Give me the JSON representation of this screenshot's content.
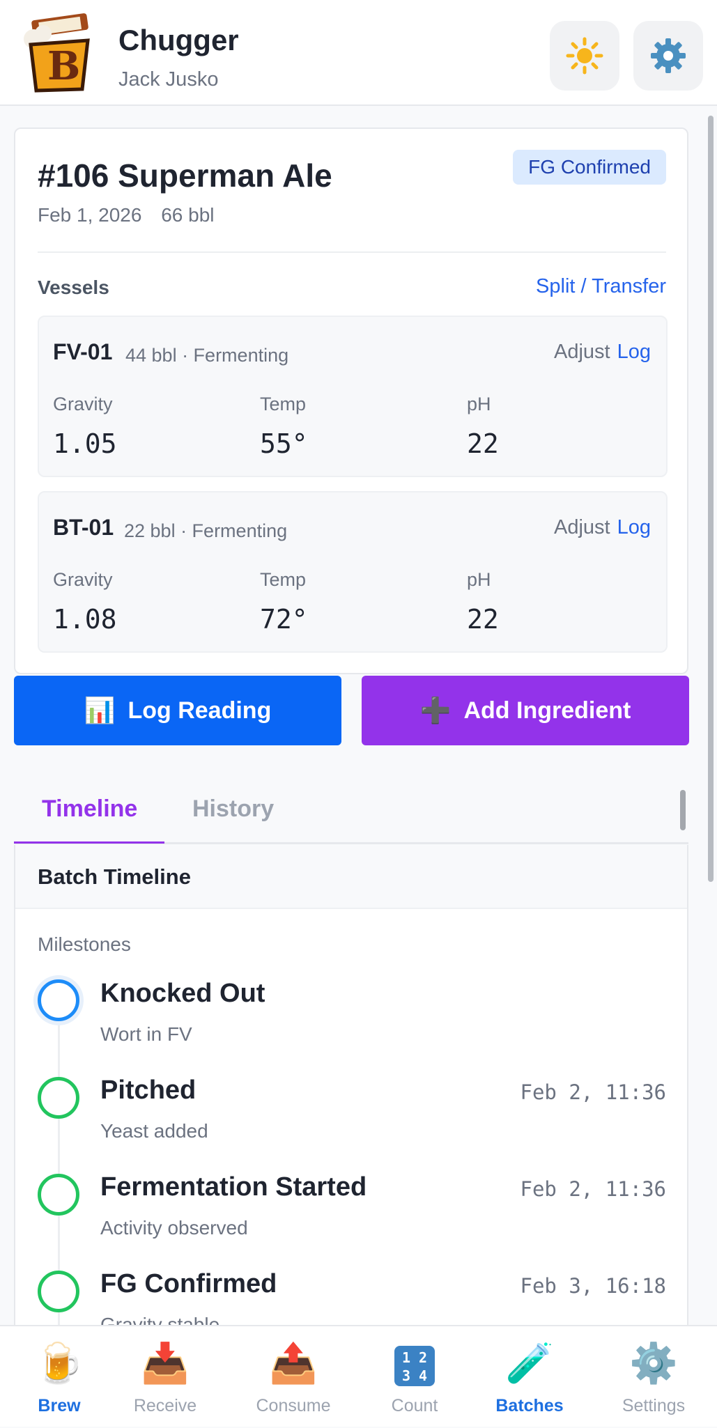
{
  "app": {
    "title": "Chugger",
    "user": "Jack Jusko"
  },
  "header": {
    "theme_icon": "sun-icon",
    "settings_icon": "gear-icon"
  },
  "batch": {
    "title": "#106 Superman Ale",
    "status": "FG Confirmed",
    "date": "Feb 1, 2026",
    "volume": "66 bbl",
    "vessels_label": "Vessels",
    "split_label": "Split / Transfer",
    "vessels": [
      {
        "name": "FV-01",
        "info": "44 bbl · Fermenting",
        "adjust": "Adjust",
        "log": "Log",
        "gravity_label": "Gravity",
        "gravity": "1.05",
        "temp_label": "Temp",
        "temp": "55°",
        "ph_label": "pH",
        "ph": "22"
      },
      {
        "name": "BT-01",
        "info": "22 bbl · Fermenting",
        "adjust": "Adjust",
        "log": "Log",
        "gravity_label": "Gravity",
        "gravity": "1.08",
        "temp_label": "Temp",
        "temp": "72°",
        "ph_label": "pH",
        "ph": "22"
      }
    ]
  },
  "actions": {
    "log_reading": "Log Reading",
    "log_reading_icon": "📊",
    "add_ingredient": "Add Ingredient",
    "add_ingredient_icon": "➕"
  },
  "tabs": {
    "timeline": "Timeline",
    "history": "History"
  },
  "timeline": {
    "title": "Batch Timeline",
    "milestones_label": "Milestones",
    "items": [
      {
        "title": "Knocked Out",
        "sub": "Wort in FV",
        "time": ""
      },
      {
        "title": "Pitched",
        "sub": "Yeast added",
        "time": "Feb 2, 11:36"
      },
      {
        "title": "Fermentation Started",
        "sub": "Activity observed",
        "time": "Feb 2, 11:36"
      },
      {
        "title": "FG Confirmed",
        "sub": "Gravity stable",
        "time": "Feb 3, 16:18"
      }
    ]
  },
  "nav": [
    {
      "label": "Brew",
      "icon": "🍺",
      "active": true
    },
    {
      "label": "Receive",
      "icon": "📥",
      "active": false
    },
    {
      "label": "Consume",
      "icon": "📤",
      "active": false
    },
    {
      "label": "Count",
      "icon": "1 2 3 4",
      "active": false
    },
    {
      "label": "Batches",
      "icon": "🧪",
      "active": false
    },
    {
      "label": "Settings",
      "icon": "⚙️",
      "active": false
    }
  ],
  "colors": {
    "primary_blue": "#0a66f5",
    "purple": "#9333ea",
    "link_blue": "#2563eb",
    "milestone_green": "#22c55e",
    "current_milestone": "#1d8cf8",
    "badge_bg": "#dbeafe"
  }
}
